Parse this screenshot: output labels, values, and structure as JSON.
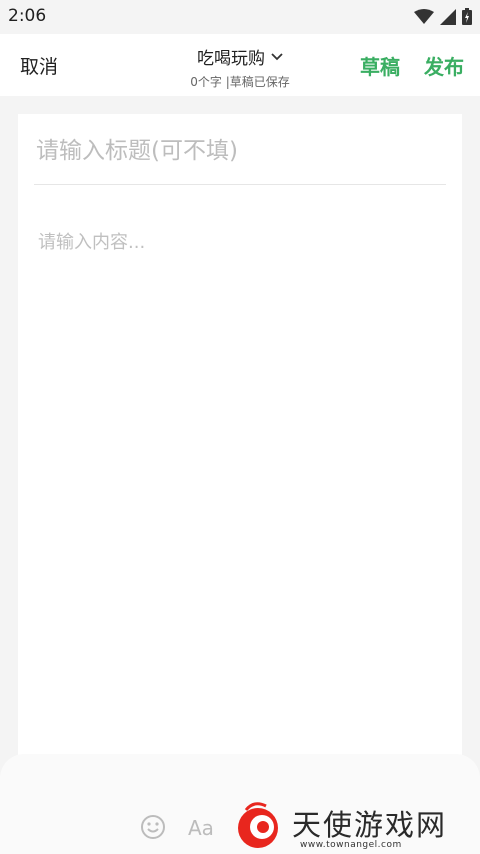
{
  "status_bar": {
    "time": "2:06",
    "icons": [
      "wifi-icon",
      "signal-icon",
      "battery-icon"
    ]
  },
  "header": {
    "cancel_label": "取消",
    "category": "吃喝玩购",
    "subtitle": "0个字 |草稿已保存",
    "draft_label": "草稿",
    "publish_label": "发布"
  },
  "editor": {
    "title_placeholder": "请输入标题(可不填)",
    "title_value": "",
    "content_placeholder": "请输入内容...",
    "content_value": ""
  },
  "toolbar": {
    "font_label": "Aa",
    "icons": [
      "emoji-icon",
      "font-style-icon"
    ]
  },
  "watermark": {
    "text": "天使游戏网",
    "url": "www.townangel.com"
  },
  "colors": {
    "accent": "#3aae62",
    "background": "#f4f4f4",
    "card": "#ffffff",
    "logo_red": "#e8261e"
  }
}
